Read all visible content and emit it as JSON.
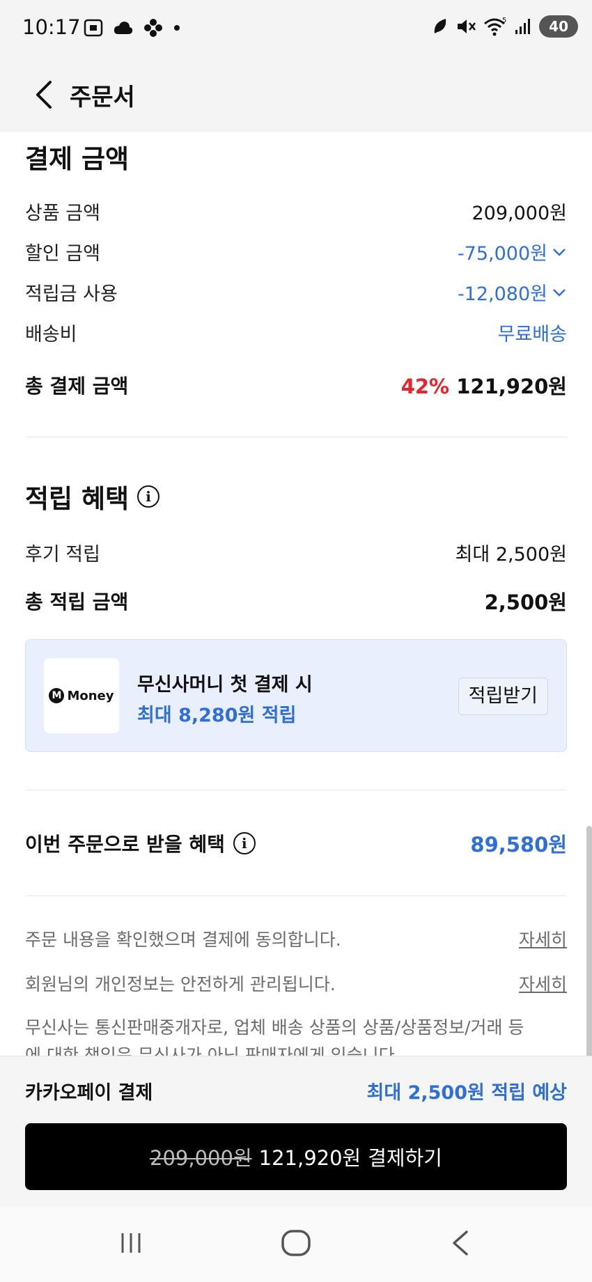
{
  "status_bar": {
    "time": "10:17",
    "battery": "40",
    "network": "5"
  },
  "header": {
    "title": "주문서"
  },
  "payment_summary": {
    "title": "결제 금액",
    "rows": [
      {
        "label": "상품 금액",
        "value": "209,000원",
        "style": "normal"
      },
      {
        "label": "할인 금액",
        "value": "-75,000원",
        "style": "blue-dropdown"
      },
      {
        "label": "적립금 사용",
        "value": "-12,080원",
        "style": "blue-dropdown"
      },
      {
        "label": "배송비",
        "value": "무료배송",
        "style": "blue"
      }
    ],
    "total_label": "총 결제 금액",
    "total_discount_rate": "42%",
    "total_value": "121,920원"
  },
  "reward": {
    "title": "적립 혜택",
    "review_label": "후기 적립",
    "review_value": "최대 2,500원",
    "total_label": "총 적립 금액",
    "total_value": "2,500원"
  },
  "money_promo": {
    "logo_letter": "M",
    "logo_text": "Money",
    "line1": "무신사머니 첫 결제 시",
    "line2": "최대 8,280원 적립",
    "button": "적립받기"
  },
  "benefit": {
    "label": "이번 주문으로 받을 혜택",
    "value": "89,580원"
  },
  "notices": [
    {
      "text": "주문 내용을 확인했으며 결제에 동의합니다.",
      "link": "자세히"
    },
    {
      "text": "회원님의 개인정보는 안전하게 관리됩니다.",
      "link": "자세히"
    }
  ],
  "disclaimer_line1": "무신사는 통신판매중개자로, 업체 배송 상품의 상품/상품정보/거래 등",
  "disclaimer_line2": "에 대한 책임은 무신사가 아닌 판매자에게 있습니다.",
  "pay_bar": {
    "method": "카카오페이 결제",
    "points": "최대 2,500원 적립 예상",
    "original_price": "209,000원",
    "final_price": "121,920원",
    "action": "결제하기"
  },
  "colors": {
    "accent_blue": "#2f6fd6",
    "discount_red": "#e4252c",
    "header_bg": "#f4f4f4"
  }
}
